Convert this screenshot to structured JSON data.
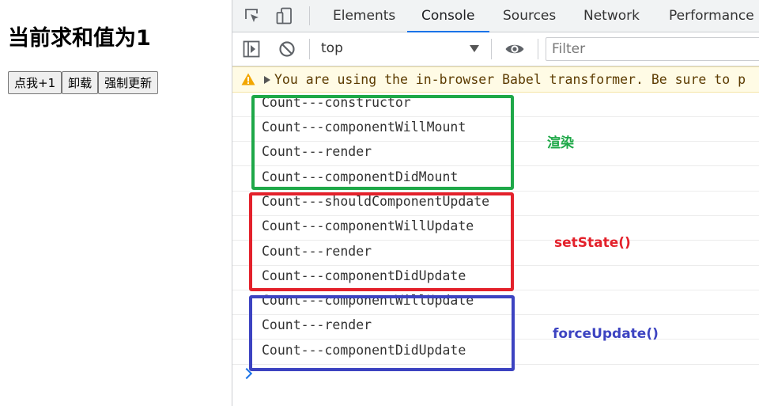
{
  "app": {
    "title": "当前求和值为1",
    "buttons": [
      {
        "label": "点我+1"
      },
      {
        "label": "卸载"
      },
      {
        "label": "强制更新"
      }
    ]
  },
  "devtools": {
    "tabs": [
      {
        "label": "Elements",
        "active": false
      },
      {
        "label": "Console",
        "active": true
      },
      {
        "label": "Sources",
        "active": false
      },
      {
        "label": "Network",
        "active": false
      },
      {
        "label": "Performance",
        "active": false
      }
    ],
    "toolbar_icons": [
      "inspect-element-icon",
      "device-toolbar-icon"
    ],
    "console_toolbar": {
      "icons": [
        "sidebar-toggle-icon",
        "clear-console-icon",
        "live-expression-eye-icon"
      ],
      "context": "top",
      "filter_placeholder": "Filter"
    },
    "warning": {
      "icon": "warning-triangle-icon",
      "text": "You are using the in-browser Babel transformer. Be sure to p"
    },
    "logs": [
      "Count---constructor",
      "Count---componentWillMount",
      "Count---render",
      "Count---componentDidMount",
      "Count---shouldComponentUpdate",
      "Count---componentWillUpdate",
      "Count---render",
      "Count---componentDidUpdate",
      "Count---componentWillUpdate",
      "Count---render",
      "Count---componentDidUpdate"
    ]
  },
  "annotations": [
    {
      "label": "渲染",
      "color": "#1ea848"
    },
    {
      "label": "setState()",
      "color": "#e3212b"
    },
    {
      "label": "forceUpdate()",
      "color": "#3c43c1"
    }
  ],
  "colors": {
    "active_tab_underline": "#1a73e8",
    "warning_background": "#fffbe5",
    "warning_icon": "#f2a600"
  }
}
